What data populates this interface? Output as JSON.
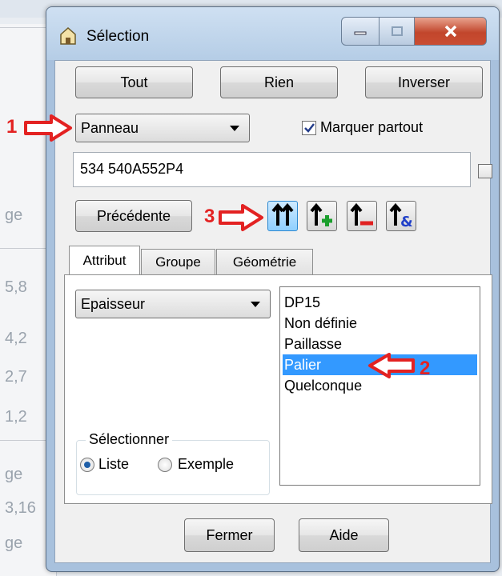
{
  "background": {
    "fragments": [
      "ge",
      "5,8",
      "4,2",
      "2,7",
      "1,2",
      "ge",
      "3,16",
      "ge"
    ]
  },
  "window": {
    "title": "Sélection",
    "controls": {
      "minimize": "minimize",
      "maximize": "maximize",
      "close": "close"
    }
  },
  "top_buttons": {
    "all": "Tout",
    "none": "Rien",
    "invert": "Inverser"
  },
  "type_combo": {
    "value": "Panneau"
  },
  "mark_everywhere": {
    "label": "Marquer partout",
    "checked": true
  },
  "name_input": {
    "value": "534 540A552P4"
  },
  "side_checkbox": {
    "checked": false
  },
  "previous_button": "Précédente",
  "tool_icons": {
    "select_all": "double-up-arrow-icon",
    "add": "up-arrow-plus-icon",
    "remove": "up-arrow-minus-icon",
    "intersect": "up-arrow-ampersand-icon"
  },
  "tabs": [
    {
      "label": "Attribut",
      "active": true
    },
    {
      "label": "Groupe",
      "active": false
    },
    {
      "label": "Géométrie",
      "active": false
    }
  ],
  "attribute_combo": {
    "value": "Epaisseur"
  },
  "value_list": {
    "items": [
      "DP15",
      "Non définie",
      "Paillasse",
      "Palier",
      "Quelconque"
    ],
    "selected": "Palier"
  },
  "select_group": {
    "legend": "Sélectionner",
    "options": [
      {
        "label": "Liste",
        "checked": true
      },
      {
        "label": "Exemple",
        "checked": false
      }
    ]
  },
  "bottom_buttons": {
    "close": "Fermer",
    "help": "Aide"
  },
  "annotations": {
    "one": "1",
    "two": "2",
    "three": "3",
    "color": "#e32222"
  }
}
